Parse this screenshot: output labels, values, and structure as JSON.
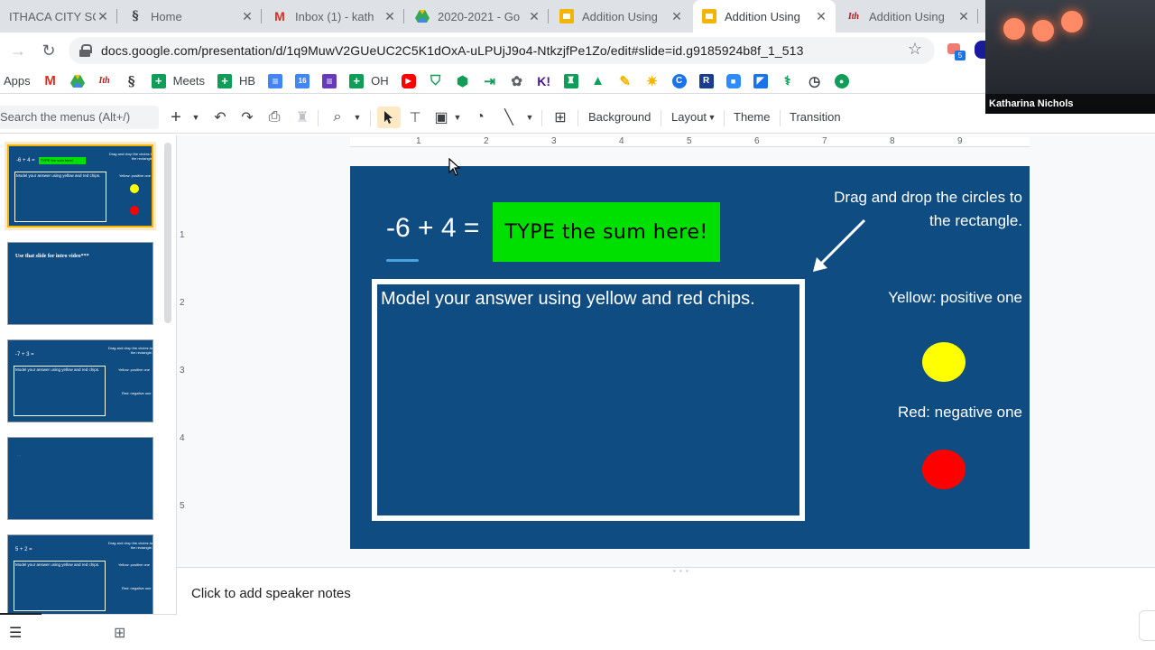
{
  "browser": {
    "tabs": [
      {
        "label": "ITHACA CITY SC",
        "favicon": "ithaca-logo-icon"
      },
      {
        "label": "Home",
        "favicon": "s-logo-icon"
      },
      {
        "label": "Inbox (1) - kath",
        "favicon": "gmail-icon"
      },
      {
        "label": "2020-2021 - Go",
        "favicon": "google-drive-icon"
      },
      {
        "label": "Addition Using",
        "favicon": "google-slides-icon"
      },
      {
        "label": "Addition Using",
        "favicon": "google-slides-icon",
        "active": true
      },
      {
        "label": "Addition Using",
        "favicon": "ithaca-logo-icon"
      }
    ],
    "url": "docs.google.com/presentation/d/1q9MuwV2GUeUC2C5K1dOxA-uLPUjJ9o4-NtkzjfPe1Zo/edit#slide=id.g9185924b8f_1_513",
    "extension_badge": "5"
  },
  "bookmarks": [
    {
      "label": "Apps",
      "icon": "apps-icon"
    },
    {
      "label": "",
      "icon": "gmail-icon"
    },
    {
      "label": "",
      "icon": "ithaca-logo-icon"
    },
    {
      "label": "",
      "icon": "s-logo-icon"
    },
    {
      "label": "Meets",
      "icon": "green-plus-icon"
    },
    {
      "label": "HB",
      "icon": "green-plus-icon"
    },
    {
      "label": "",
      "icon": "google-docs-icon"
    },
    {
      "label": "",
      "icon": "google-calendar-icon"
    },
    {
      "label": "",
      "icon": "google-forms-icon"
    },
    {
      "label": "OH",
      "icon": "green-plus-icon"
    },
    {
      "label": "",
      "icon": "youtube-icon"
    },
    {
      "label": "",
      "icon": "shield-icon"
    },
    {
      "label": "",
      "icon": "hexagon-icon"
    },
    {
      "label": "",
      "icon": "login-arrow-icon"
    },
    {
      "label": "",
      "icon": "gear-outline-icon"
    },
    {
      "label": "",
      "icon": "kahoot-icon"
    },
    {
      "label": "",
      "icon": "classroom-icon"
    },
    {
      "label": "",
      "icon": "triangle-a-icon"
    },
    {
      "label": "",
      "icon": "pencil-icon"
    },
    {
      "label": "",
      "icon": "star-sketch-icon"
    },
    {
      "label": "",
      "icon": "c-circle-icon"
    },
    {
      "label": "",
      "icon": "r-square-icon"
    },
    {
      "label": "",
      "icon": "zoom-icon"
    },
    {
      "label": "",
      "icon": "flag-icon"
    },
    {
      "label": "",
      "icon": "stethoscope-icon"
    },
    {
      "label": "",
      "icon": "timer-icon"
    },
    {
      "label": "",
      "icon": "chat-bubble-icon"
    }
  ],
  "toolbar": {
    "search_placeholder": "Search the menus (Alt+/)",
    "background": "Background",
    "layout": "Layout",
    "theme": "Theme",
    "transition": "Transition"
  },
  "ruler": {
    "h_numbers": [
      "1",
      "2",
      "3",
      "4",
      "5",
      "6",
      "7",
      "8",
      "9"
    ],
    "v_numbers": [
      "1",
      "2",
      "3",
      "4",
      "5"
    ]
  },
  "slide": {
    "equation": "-6 + 4 =",
    "answer_box": "TYPE the sum here!",
    "model_text": "Model your answer using yellow and red chips.",
    "drag_text_line1": "Drag and drop the circles to",
    "drag_text_line2": "the rectangle.",
    "yellow_label": "Yellow: positive one",
    "red_label": "Red: negative one",
    "background_color": "#0f4c81",
    "yellow_color": "#ffff00",
    "red_color": "#ff0000",
    "answer_box_color": "#00e000"
  },
  "filmstrip": [
    {
      "type": "main",
      "equation": "-6 + 4 =",
      "answer": "TYPE the sum here!",
      "drag": "Drag and drop the circles to the rectangle.",
      "model": "Model your answer using yellow and red chips.",
      "yellow": "Yellow: positive one",
      "active": true
    },
    {
      "type": "title",
      "title": "Use that slide for intro video***"
    },
    {
      "type": "main",
      "equation": "-7 + 3 =",
      "drag": "Drag and drop the circles to the rectangle.",
      "model": "Model your answer using yellow and red chips.",
      "yellow": "Yellow: positive one",
      "red": "Red: negative one"
    },
    {
      "type": "blank",
      "title": "..."
    },
    {
      "type": "main",
      "equation": "5 + 2 =",
      "drag": "Drag and drop the circles to the rectangle.",
      "model": "Model your answer using yellow and red chips.",
      "yellow": "Yellow: positive one",
      "red": "Red: negative one"
    }
  ],
  "notes": {
    "placeholder": "Click to add speaker notes"
  },
  "video": {
    "participant_name": "Katharina Nichols"
  }
}
